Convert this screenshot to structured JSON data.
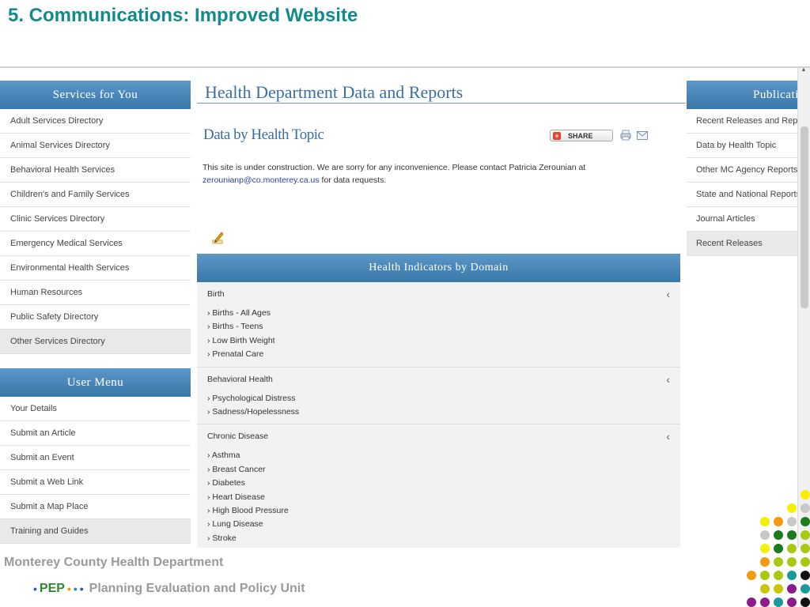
{
  "slide": {
    "title": "5. Communications: Improved Website",
    "org_name": "Monterey County Health Department",
    "unit_acronym": "PEP",
    "unit_name": "Planning Evaluation and Policy Unit",
    "bullet_glyph": "•",
    "title_color": "#138a8c"
  },
  "services_panel": {
    "title": "Services for You",
    "items": [
      "Adult Services Directory",
      "Animal Services Directory",
      "Behavioral Health Services",
      "Children's and Family Services",
      "Clinic Services Directory",
      "Emergency Medical Services",
      "Environmental Health Services",
      "Human Resources",
      "Public Safety Directory",
      "Other Services Directory"
    ]
  },
  "user_menu": {
    "title": "User Menu",
    "items": [
      "Your Details",
      "Submit an Article",
      "Submit an Event",
      "Submit a Web Link",
      "Submit a Map Place",
      "Training and Guides"
    ]
  },
  "main": {
    "heading": "Health Department Data and Reports",
    "section_heading": "Data by Health Topic",
    "share_label": "SHARE",
    "notice_text": "This site is under construction. We are sorry for any inconvenience. Please contact Patricia Zerounian at",
    "notice_email": "zerounianp@co.monterey.ca.us",
    "notice_suffix": " for data requests.",
    "icons": [
      "share-icon",
      "print-icon",
      "mail-icon",
      "edit-icon",
      "chevron-left-icon"
    ]
  },
  "indicators": {
    "title": "Health Indicators by Domain",
    "chevron": "‹",
    "item_prefix": "›",
    "domains": [
      {
        "title": "Birth",
        "items": [
          "Births - All Ages",
          "Births - Teens",
          "Low Birth Weight",
          "Prenatal Care"
        ]
      },
      {
        "title": "Behavioral Health",
        "items": [
          "Psychological Distress",
          "Sadness/Hopelessness"
        ]
      },
      {
        "title": "Chronic Disease",
        "items": [
          "Asthma",
          "Breast Cancer",
          "Diabetes",
          "Heart Disease",
          "High Blood Pressure",
          "Lung Disease",
          "Stroke"
        ]
      }
    ]
  },
  "publications_panel": {
    "title": "Publications",
    "items": [
      "Recent Releases and Reports",
      "Data by Health Topic",
      "Other MC Agency Reports",
      "State and National Reports",
      "Journal Articles",
      "Recent Releases"
    ]
  },
  "decor": {
    "colors": {
      "yellow": "#f5f000",
      "lime": "#a8c812",
      "olive": "#c8c800",
      "green": "#1e7a1e",
      "orange": "#f39a0e",
      "gray": "#c8c8c8",
      "teal": "#1a9a9a",
      "purple": "#8b1a8b",
      "black": "#111111"
    },
    "dot_rows": [
      [
        "yellow"
      ],
      [
        "yellow",
        "gray"
      ],
      [
        "yellow",
        "orange",
        "gray",
        "green"
      ],
      [
        "gray",
        "green",
        "green",
        "lime"
      ],
      [
        "yellow",
        "green",
        "lime",
        "lime"
      ],
      [
        "orange",
        "lime",
        "lime",
        "lime"
      ],
      [
        "orange",
        "lime",
        "lime",
        "teal",
        "black"
      ],
      [
        "olive",
        "olive",
        "purple",
        "teal"
      ],
      [
        "purple",
        "purple",
        "teal",
        "purple",
        "black"
      ]
    ]
  }
}
